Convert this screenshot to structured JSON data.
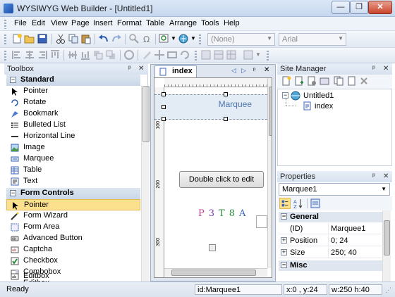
{
  "window": {
    "title": "WYSIWYG Web Builder - [Untitled1]",
    "min": "—",
    "max": "❐",
    "close": "✕"
  },
  "menu": [
    "File",
    "Edit",
    "View",
    "Page",
    "Insert",
    "Format",
    "Table",
    "Arrange",
    "Tools",
    "Help"
  ],
  "toolbar": {
    "combo_style": "(None)",
    "combo_font": "Arial",
    "icons_row1": [
      "new-icon",
      "open-icon",
      "save-icon",
      "cut-icon",
      "copy-icon",
      "paste-icon",
      "undo-icon",
      "redo-icon",
      "find-icon",
      "symbol-icon",
      "zoom-icon",
      "preview-icon",
      "publish-icon"
    ],
    "icons_row2": [
      "align-left-icon",
      "align-center-icon",
      "align-right-icon",
      "align-top-icon",
      "align-middle-icon",
      "align-bottom-icon",
      "bring-front-icon",
      "send-back-icon",
      "group-icon",
      "ungroup-icon",
      "lock-icon",
      "grid-icon",
      "bold-icon",
      "italic-icon",
      "underline-icon",
      "link-icon",
      "form-icon"
    ]
  },
  "toolbox": {
    "title": "Toolbox",
    "pin": "ᵖ ✕",
    "groups": [
      {
        "label": "Standard",
        "items": [
          "Pointer",
          "Rotate",
          "Bookmark",
          "Bulleted List",
          "Horizontal Line",
          "Image",
          "Marquee",
          "Table",
          "Text"
        ]
      },
      {
        "label": "Form Controls",
        "items": [
          "Pointer",
          "Form Wizard",
          "Form Area",
          "Advanced Button",
          "Captcha",
          "Checkbox",
          "Combobox",
          "Editbox"
        ]
      }
    ],
    "selected": "Pointer (Form Controls)"
  },
  "editor": {
    "tab_label": "index",
    "marquee_text": "Marquee",
    "button_text": "Double click to edit",
    "captcha_text": "P 3 T8 A",
    "ruler_labels": [
      "100",
      "200",
      "300"
    ]
  },
  "site_manager": {
    "title": "Site Manager",
    "tree_root": "Untitled1",
    "tree_child": "index"
  },
  "properties": {
    "title": "Properties",
    "object": "Marquee1",
    "categories": [
      {
        "label": "General",
        "rows": [
          {
            "key": "(ID)",
            "value": "Marquee1"
          },
          {
            "key": "Position",
            "value": "0; 24"
          },
          {
            "key": "Size",
            "value": "250; 40"
          }
        ]
      },
      {
        "label": "Misc",
        "rows": []
      }
    ]
  },
  "status": {
    "ready": "Ready",
    "id": "id:Marquee1",
    "pos": "x:0 , y:24",
    "size": "w:250 h:40"
  }
}
